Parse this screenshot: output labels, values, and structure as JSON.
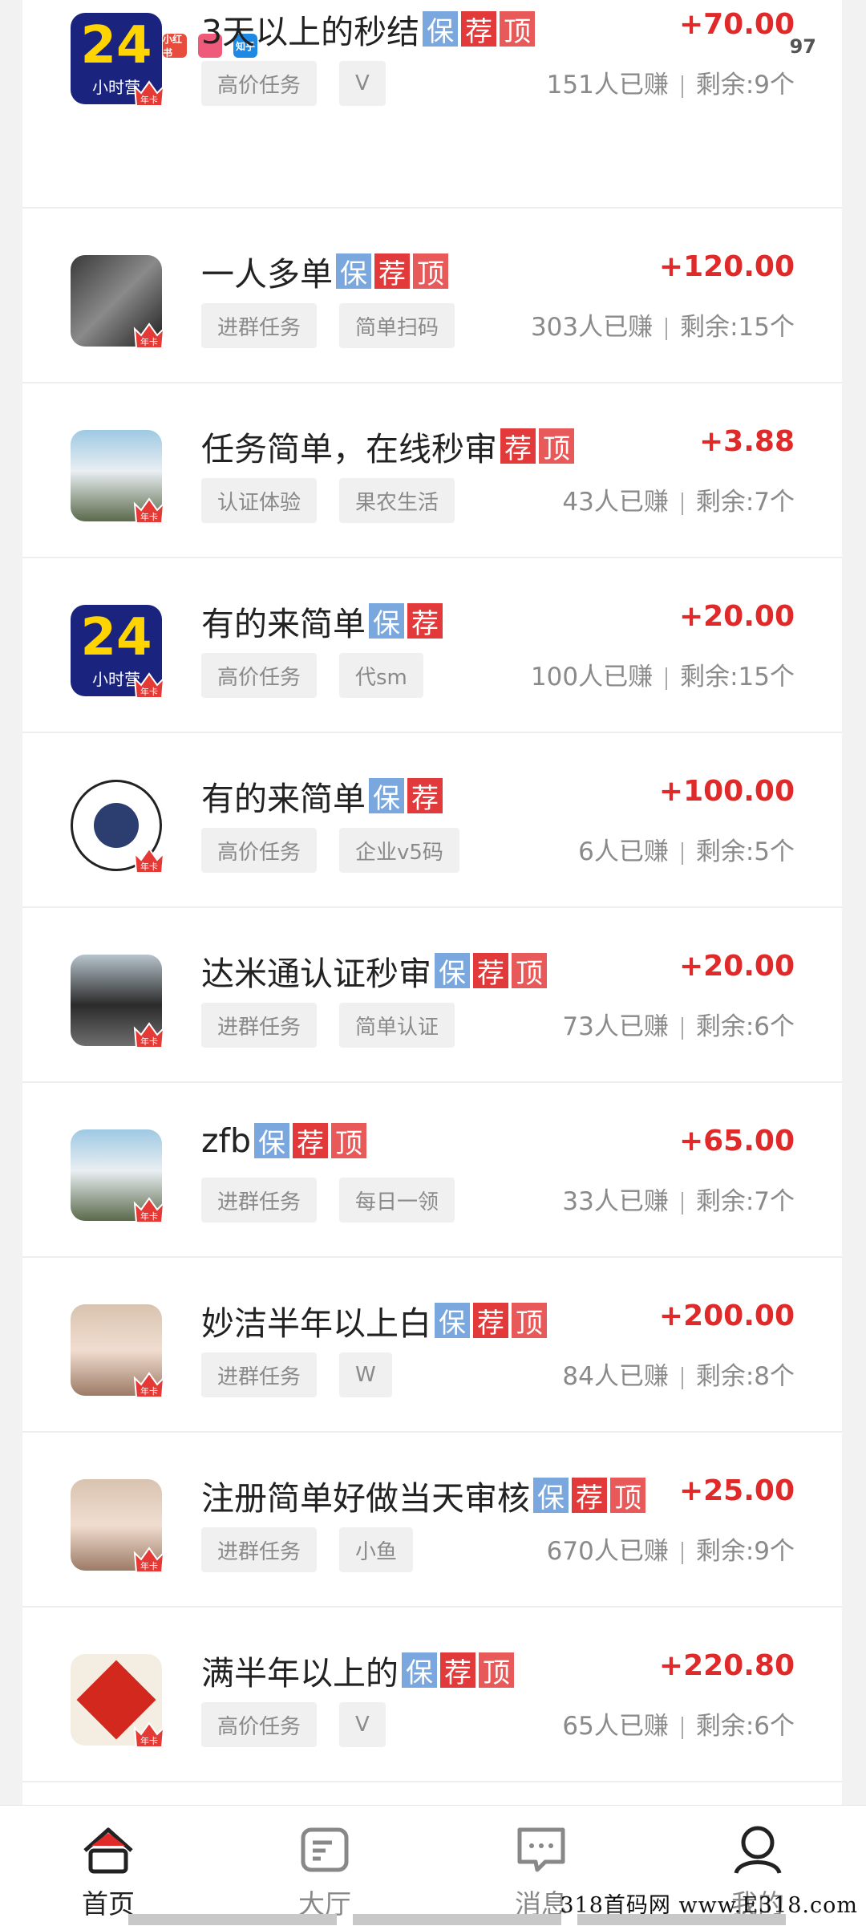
{
  "status_bar": {
    "battery": "97",
    "notif_icons": [
      {
        "name": "xiaohongshu-icon",
        "label": "小红书",
        "color": "#e74c3c"
      },
      {
        "name": "app-icon",
        "label": "",
        "color": "#f05a7a"
      },
      {
        "name": "zhihu-icon",
        "label": "知乎",
        "color": "#1e88e5"
      }
    ]
  },
  "badges": {
    "bao": "保",
    "jian": "荐",
    "ding": "顶"
  },
  "tasks": [
    {
      "title": "3天以上的秒结",
      "badges": [
        "bao",
        "jian",
        "ding"
      ],
      "price": "+70.00",
      "tags": [
        "高价任务",
        "V"
      ],
      "earned": "151人已赚",
      "remaining": "剩余:9个",
      "avatar": "avatar-24-hour"
    },
    {
      "title": "一人多单",
      "badges": [
        "bao",
        "jian",
        "ding"
      ],
      "price": "+120.00",
      "tags": [
        "进群任务",
        "简单扫码"
      ],
      "earned": "303人已赚",
      "remaining": "剩余:15个",
      "avatar": "avatar-photo"
    },
    {
      "title": "任务简单，在线秒审",
      "badges": [
        "jian",
        "ding"
      ],
      "price": "+3.88",
      "tags": [
        "认证体验",
        "果农生活"
      ],
      "earned": "43人已赚",
      "remaining": "剩余:7个",
      "avatar": "avatar-person"
    },
    {
      "title": "有的来简单",
      "badges": [
        "bao",
        "jian"
      ],
      "price": "+20.00",
      "tags": [
        "高价任务",
        "代sm"
      ],
      "earned": "100人已赚",
      "remaining": "剩余:15个",
      "avatar": "avatar-24-hour"
    },
    {
      "title": "有的来简单",
      "badges": [
        "bao",
        "jian"
      ],
      "price": "+100.00",
      "tags": [
        "高价任务",
        "企业v5码"
      ],
      "earned": "6人已赚",
      "remaining": "剩余:5个",
      "avatar": "avatar-cartoon"
    },
    {
      "title": "达米通认证秒审",
      "badges": [
        "bao",
        "jian",
        "ding"
      ],
      "price": "+20.00",
      "tags": [
        "进群任务",
        "简单认证"
      ],
      "earned": "73人已赚",
      "remaining": "剩余:6个",
      "avatar": "avatar-car"
    },
    {
      "title": "zfb",
      "badges": [
        "bao",
        "jian",
        "ding"
      ],
      "price": "+65.00",
      "tags": [
        "进群任务",
        "每日一领"
      ],
      "earned": "33人已赚",
      "remaining": "剩余:7个",
      "avatar": "avatar-person"
    },
    {
      "title": "妙洁半年以上白",
      "badges": [
        "bao",
        "jian",
        "ding"
      ],
      "price": "+200.00",
      "tags": [
        "进群任务",
        "W"
      ],
      "earned": "84人已赚",
      "remaining": "剩余:8个",
      "avatar": "avatar-girl"
    },
    {
      "title": "注册简单好做当天审核",
      "badges": [
        "bao",
        "jian",
        "ding"
      ],
      "price": "+25.00",
      "tags": [
        "进群任务",
        "小鱼"
      ],
      "earned": "670人已赚",
      "remaining": "剩余:9个",
      "avatar": "avatar-girl"
    },
    {
      "title": "满半年以上的",
      "badges": [
        "bao",
        "jian",
        "ding"
      ],
      "price": "+220.80",
      "tags": [
        "高价任务",
        "V"
      ],
      "earned": "65人已赚",
      "remaining": "剩余:6个",
      "avatar": "avatar-calligraphy"
    }
  ],
  "avatar_label_24": "24",
  "avatar_sub_24": "小时营",
  "crown_text": "年卡",
  "tabs": [
    {
      "label": "首页",
      "icon": "home-icon",
      "active": true
    },
    {
      "label": "大厅",
      "icon": "hall-icon",
      "active": false
    },
    {
      "label": "消息",
      "icon": "message-icon",
      "active": false
    },
    {
      "label": "我的",
      "icon": "profile-icon",
      "active": false
    }
  ],
  "watermark": "318首码网 www.E318.com"
}
